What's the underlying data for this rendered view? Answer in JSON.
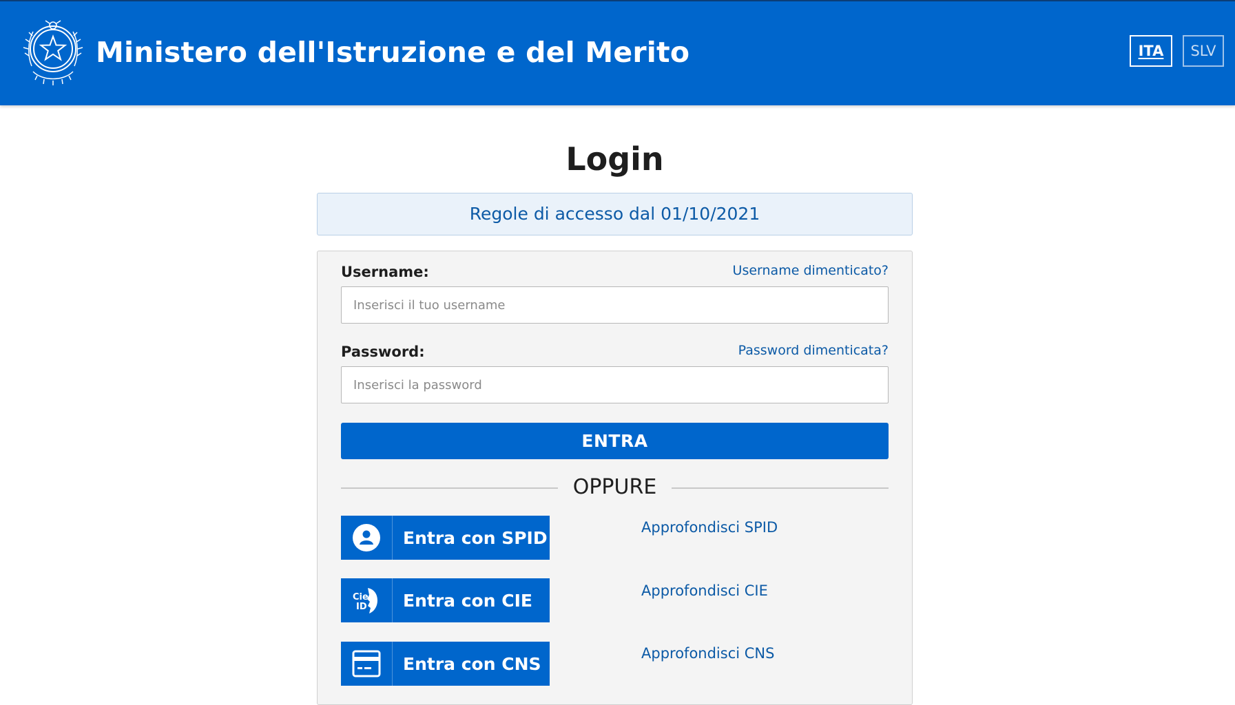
{
  "header": {
    "title": "Ministero dell'Istruzione e del Merito",
    "languages": [
      {
        "code": "ITA",
        "active": true
      },
      {
        "code": "SLV",
        "active": false
      }
    ],
    "background_color": "#0066cc"
  },
  "main": {
    "title": "Login",
    "rules_link": "Regole di accesso dal 01/10/2021"
  },
  "form": {
    "username": {
      "label": "Username:",
      "placeholder": "Inserisci il tuo username",
      "value": "",
      "forgot_label": "Username dimenticato?"
    },
    "password": {
      "label": "Password:",
      "placeholder": "Inserisci la password",
      "value": "",
      "forgot_label": "Password dimenticata?"
    },
    "submit_label": "ENTRA",
    "divider_label": "OPPURE"
  },
  "auth_options": [
    {
      "label": "Entra con SPID",
      "icon": "spid-user-icon",
      "learn_more": "Approfondisci SPID"
    },
    {
      "label": "Entra con CIE",
      "icon": "cie-id-icon",
      "learn_more": "Approfondisci CIE"
    },
    {
      "label": "Entra con CNS",
      "icon": "smart-card-icon",
      "learn_more": "Approfondisci CNS"
    }
  ],
  "colors": {
    "primary": "#0066cc",
    "link": "#0c5aa6",
    "card_background": "#f4f4f4",
    "info_box_background": "#eaf2fa"
  }
}
